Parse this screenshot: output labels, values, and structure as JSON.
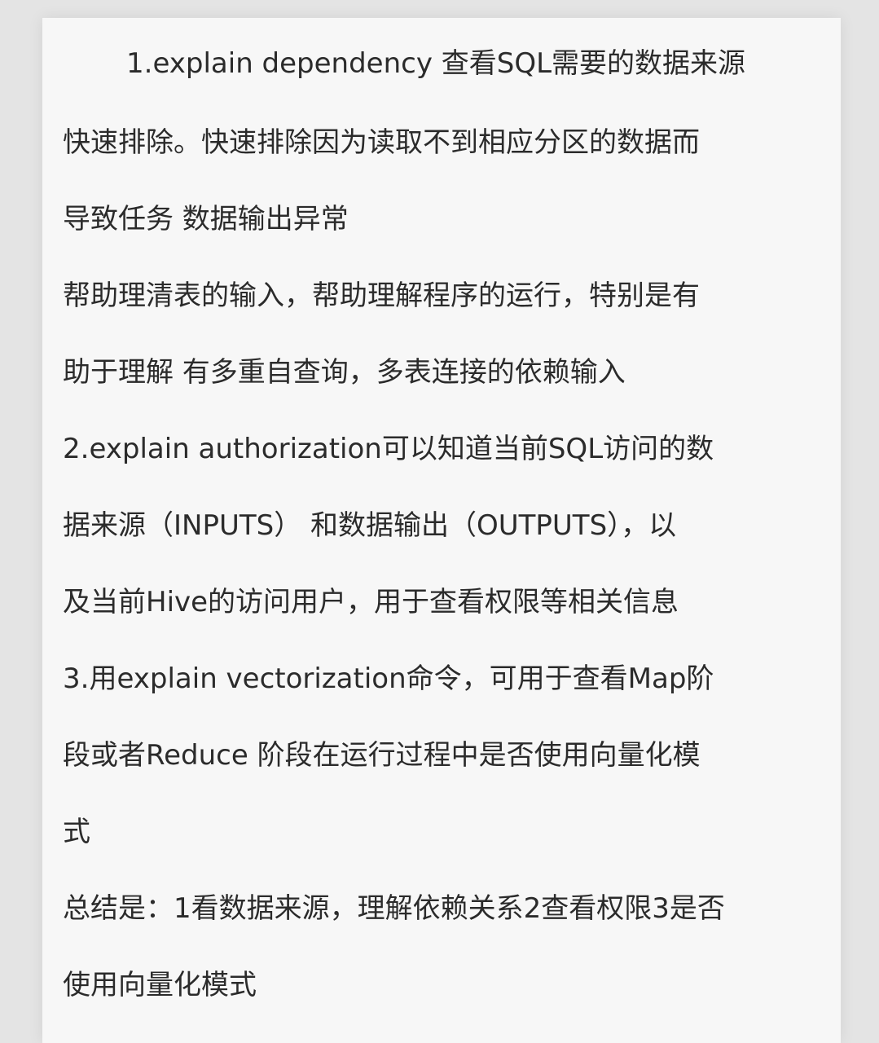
{
  "article": {
    "lines": [
      "1.explain dependency 查看SQL需要的数据来源",
      "快速排除。快速排除因为读取不到相应分区的数据而",
      "导致任务 数据输出异常",
      "帮助理清表的输入，帮助理解程序的运行，特别是有",
      "助于理解 有多重自查询，多表连接的依赖输入",
      "2.explain authorization可以知道当前SQL访问的数",
      "据来源（INPUTS） 和数据输出（OUTPUTS），以",
      "及当前Hive的访问用户，用于查看权限等相关信息",
      "3.用explain vectorization命令，可用于查看Map阶",
      "段或者Reduce 阶段在运行过程中是否使用向量化模",
      "式",
      "总结是：1看数据来源，理解依赖关系2查看权限3是否",
      "使用向量化模式"
    ]
  }
}
